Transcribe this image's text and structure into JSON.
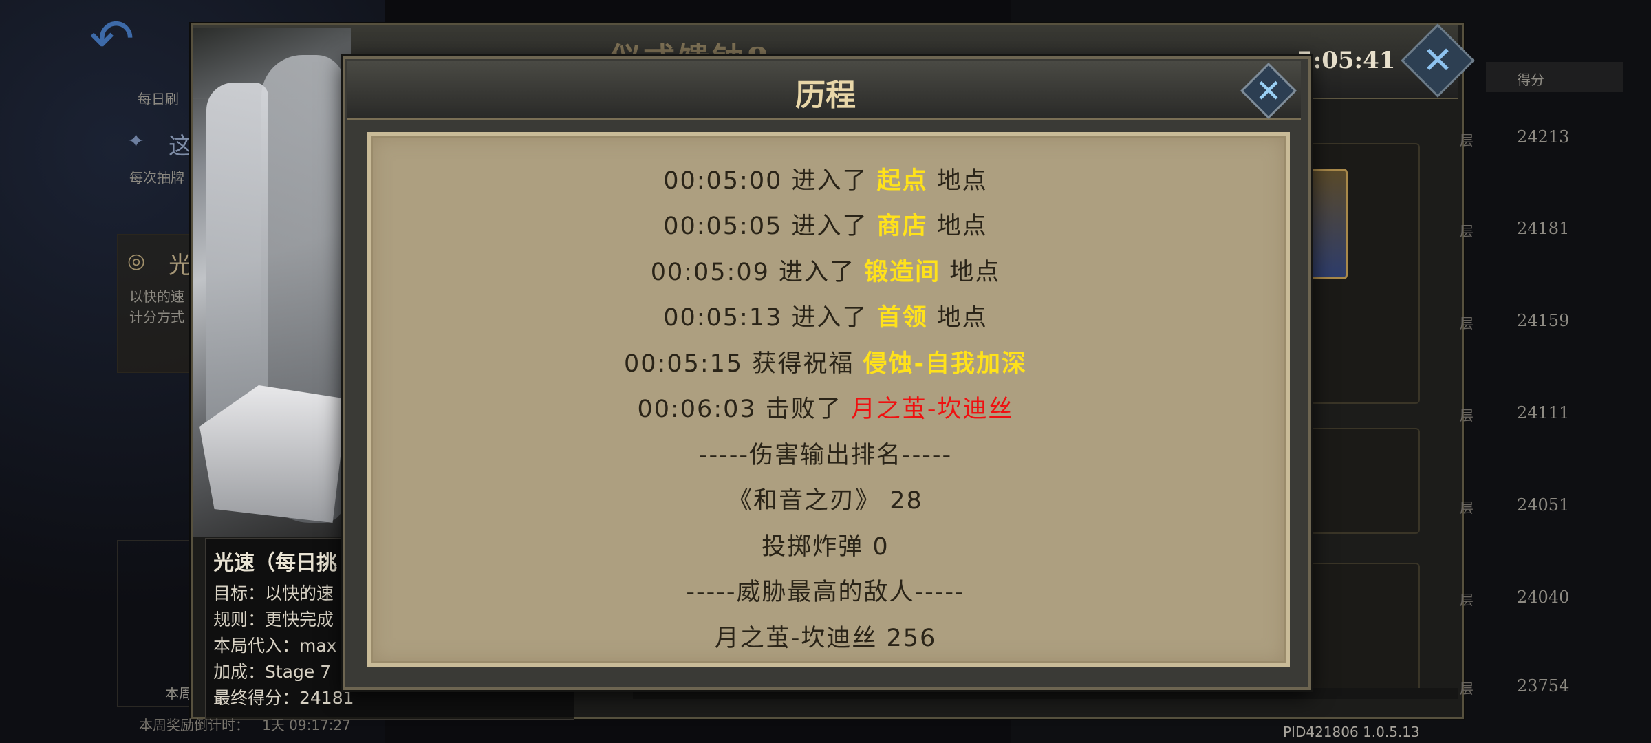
{
  "background": {
    "daily_label": "每日刷",
    "mode1_title": "这",
    "mode1_desc": "每次抽牌",
    "mode2_title": "光",
    "mode2_desc1": "以快的速",
    "mode2_desc2": "计分方式",
    "weekly_countdown_label": "本周奖励倒计时：",
    "weekly_countdown_value": "1天 09:17:27",
    "weekly_short": "本周",
    "outer_title": "仪式馈钟8",
    "timer": "5:05:41",
    "score_header": "得分",
    "rank_marker": "层",
    "scores": [
      "24213",
      "24181",
      "24159",
      "24111",
      "24051",
      "24040",
      "23754"
    ],
    "pid": "PID421806  1.0.5.13"
  },
  "info": {
    "title": "光速（每日挑",
    "line1": "目标：以快的速",
    "line2": "规则：更快完成",
    "line3": "本局代入：max",
    "line4": "加成：Stage 7",
    "line5": "最终得分：24181"
  },
  "dialog": {
    "title": "历程",
    "log": [
      {
        "pre": "00:05:00 进入了 ",
        "hl": "起点",
        "post": " 地点"
      },
      {
        "pre": "00:05:05 进入了 ",
        "hl": "商店",
        "post": " 地点"
      },
      {
        "pre": "00:05:09 进入了 ",
        "hl": "锻造间",
        "post": " 地点"
      },
      {
        "pre": "00:05:13 进入了 ",
        "hl": "首领",
        "post": " 地点"
      },
      {
        "pre": "00:05:15 获得祝福 ",
        "hl": "侵蚀-自我加深",
        "post": ""
      },
      {
        "pre": "00:06:03 击败了 ",
        "hl": "月之茧-坎迪丝",
        "post": ""
      }
    ],
    "damage_header": "-----伤害输出排名-----",
    "damage": [
      "《和音之刃》  28",
      "投掷炸弹  0"
    ],
    "threat_header": "-----威胁最高的敌人-----",
    "threat": [
      "月之茧-坎迪丝  256"
    ]
  },
  "colors": {
    "highlight": "#ffe21a",
    "enemy": "#ef1010",
    "paper": "#ad9f80",
    "close_icon": "#9ad0f5"
  }
}
